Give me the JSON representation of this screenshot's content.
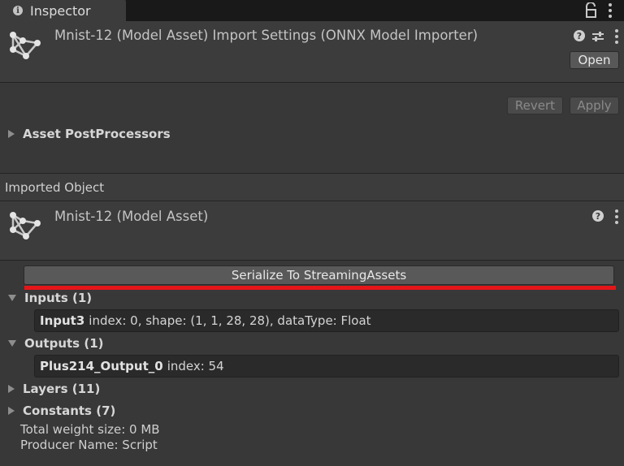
{
  "tab": {
    "label": "Inspector",
    "icon": "info-icon"
  },
  "header": {
    "title": "Mnist-12 (Model Asset) Import Settings (ONNX Model Importer)",
    "open_label": "Open"
  },
  "import_actions": {
    "revert_label": "Revert",
    "apply_label": "Apply"
  },
  "postprocessors": {
    "label": "Asset PostProcessors"
  },
  "imported_object": {
    "section_label": "Imported Object",
    "title": "Mnist-12 (Model Asset)"
  },
  "serialize_label": "Serialize To StreamingAssets",
  "inputs": {
    "label": "Inputs (1)",
    "items": [
      {
        "name": "Input3",
        "detail": "index: 0, shape: (1, 1, 28, 28), dataType: Float"
      }
    ]
  },
  "outputs": {
    "label": "Outputs (1)",
    "items": [
      {
        "name": "Plus214_Output_0",
        "detail": "index: 54"
      }
    ]
  },
  "layers": {
    "label": "Layers (11)"
  },
  "constants": {
    "label": "Constants (7)"
  },
  "info": {
    "weight_size": "Total weight size: 0 MB",
    "producer": "Producer Name: Script"
  },
  "colors": {
    "highlight": "#e4161a",
    "panel": "#3c3c3c",
    "background": "#383838"
  }
}
